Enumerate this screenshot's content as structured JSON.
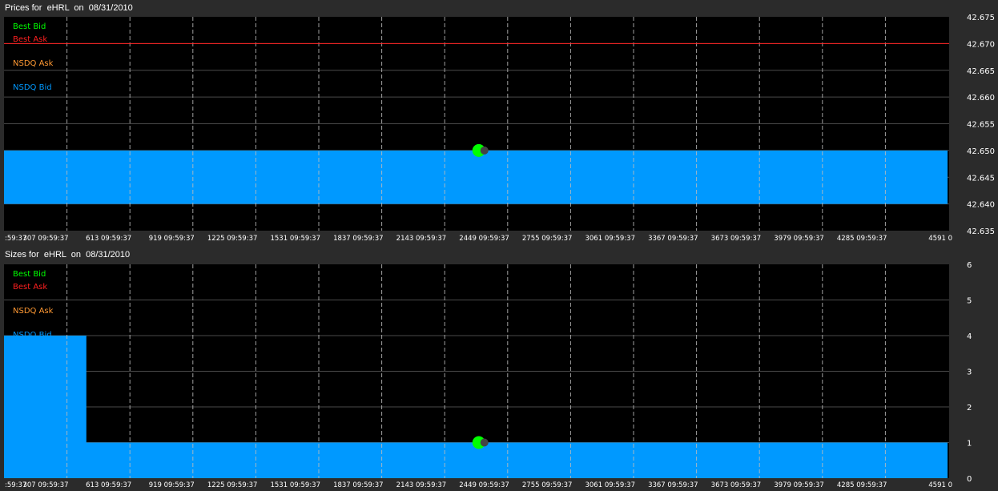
{
  "colors": {
    "plot_bg": "#000000",
    "frame_bg": "#2b2b2b",
    "grid_h": "#4a4a4a",
    "grid_v": "#bcbcbc",
    "best_bid": "#00ff00",
    "best_ask": "#ff2020",
    "nsdq_ask": "#ff9933",
    "nsdq_bid": "#0099ff",
    "text": "#ffffff"
  },
  "x_tick_labels": [
    ":59:37",
    "307 09:59:37",
    "613 09:59:37",
    "919 09:59:37",
    "1225 09:59:37",
    "1531 09:59:37",
    "1837 09:59:37",
    "2143 09:59:37",
    "2449 09:59:37",
    "2755 09:59:37",
    "3061 09:59:37",
    "3367 09:59:37",
    "3673 09:59:37",
    "3979 09:59:37",
    "4285 09:59:37",
    "4591 0"
  ],
  "chart_data": [
    {
      "type": "area",
      "title": "Prices for  eHRL  on  08/31/2010",
      "legend": [
        "Best Bid",
        "Best Ask",
        "NSDQ Ask",
        "NSDQ Bid"
      ],
      "legend_placement": "top-left",
      "y_ticks": [
        "42.675",
        "42.670",
        "42.665",
        "42.660",
        "42.655",
        "42.650",
        "42.645",
        "42.640",
        "42.635"
      ],
      "ylim": [
        42.635,
        42.675
      ],
      "xlim": [
        0,
        4591
      ],
      "grid": true,
      "series": [
        {
          "name": "Best Ask",
          "kind": "line",
          "y": 42.67
        },
        {
          "name": "NSDQ Bid",
          "kind": "band",
          "y_low": 42.64,
          "y_high": 42.65
        },
        {
          "name": "Best Bid",
          "kind": "marker",
          "x": 2314,
          "y": 42.65
        }
      ]
    },
    {
      "type": "area",
      "title": "Sizes for  eHRL  on  08/31/2010",
      "legend": [
        "Best Bid",
        "Best Ask",
        "NSDQ Ask",
        "NSDQ Bid"
      ],
      "legend_placement": "top-left",
      "y_ticks": [
        "6",
        "5",
        "4",
        "3",
        "2",
        "1",
        "0"
      ],
      "ylim": [
        0,
        6
      ],
      "xlim": [
        0,
        4591
      ],
      "grid": true,
      "series": [
        {
          "name": "NSDQ Bid",
          "kind": "step",
          "points": [
            [
              0,
              4
            ],
            [
              400,
              4
            ],
            [
              400,
              1
            ],
            [
              4591,
              1
            ]
          ]
        },
        {
          "name": "Best Bid",
          "kind": "marker",
          "x": 2314,
          "y": 1
        }
      ]
    }
  ]
}
